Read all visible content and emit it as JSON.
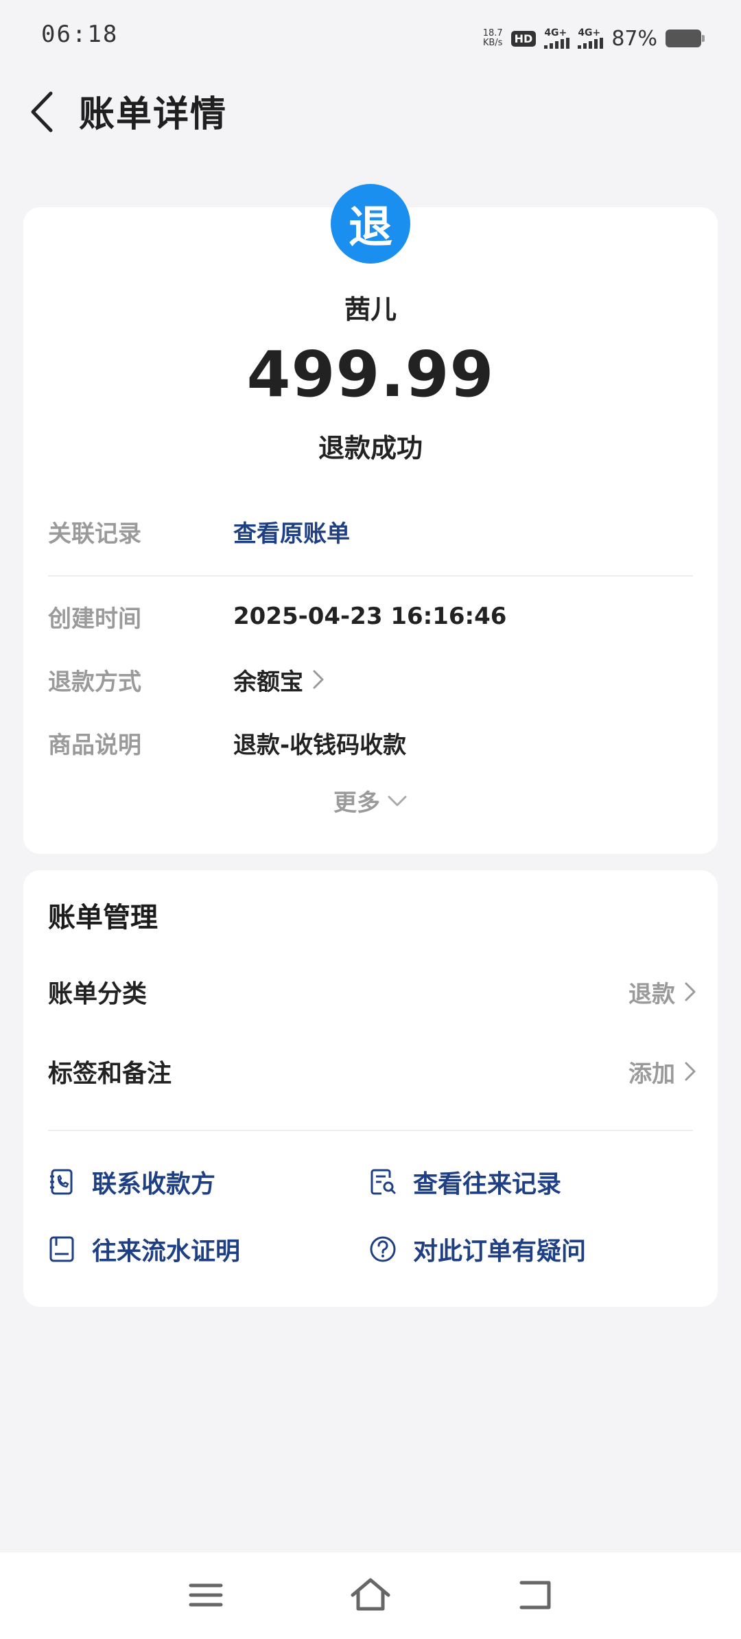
{
  "status_bar": {
    "time": "06:18",
    "net_speed_value": "18.7",
    "net_speed_unit": "KB/s",
    "hd_label": "HD",
    "network_1": "4G+",
    "network_2": "4G+",
    "battery_percent": "87%"
  },
  "header": {
    "title": "账单详情"
  },
  "transaction": {
    "avatar_char": "退",
    "merchant_name": "茜儿",
    "amount": "499.99",
    "status": "退款成功",
    "accent_color": "#1a8ff0"
  },
  "details": {
    "related_label": "关联记录",
    "related_value": "查看原账单",
    "create_time_label": "创建时间",
    "create_time_value": "2025-04-23 16:16:46",
    "refund_method_label": "退款方式",
    "refund_method_value": "余额宝",
    "product_desc_label": "商品说明",
    "product_desc_value": "退款-收钱码收款",
    "more_label": "更多"
  },
  "management": {
    "title": "账单管理",
    "category_label": "账单分类",
    "category_value": "退款",
    "tags_label": "标签和备注",
    "tags_value": "添加",
    "actions": {
      "contact_payee": "联系收款方",
      "view_history": "查看往来记录",
      "statement_proof": "往来流水证明",
      "question_order": "对此订单有疑问"
    },
    "link_color": "#1f3f84"
  }
}
